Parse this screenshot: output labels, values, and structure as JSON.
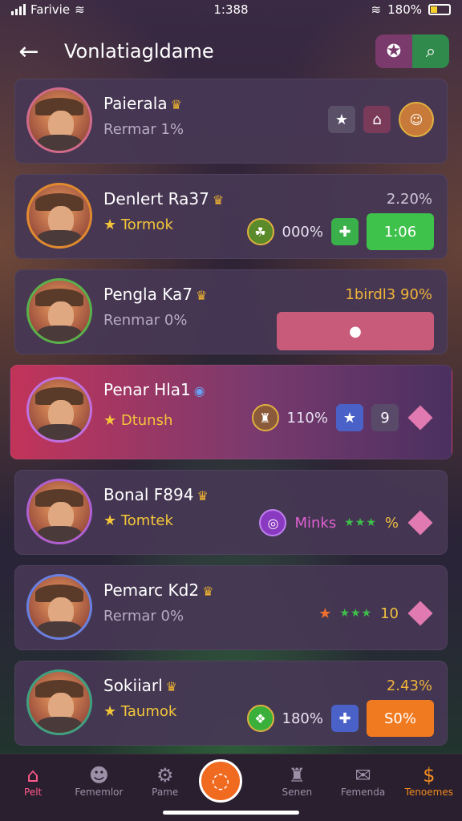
{
  "status": {
    "carrier": "Farivie",
    "time": "1:388",
    "battery": "180%"
  },
  "header": {
    "title": "Vonlatiagldame"
  },
  "cards": [
    {
      "name": "Paierala",
      "sub": "Rermar 1%",
      "right": {
        "type": "icons",
        "icons": [
          "star-icon",
          "home-icon",
          "avatar"
        ]
      }
    },
    {
      "name": "Denlert Ra37",
      "sub": "Tormok",
      "pct": "2.20%",
      "right": {
        "coin_value": "000%",
        "button": "1:06"
      }
    },
    {
      "name": "Pengla Ka7",
      "sub": "Renmar 0%",
      "pct": "1birdl3 90%",
      "right": {
        "button": ""
      }
    },
    {
      "name": "Penar Hla1",
      "sub": "Dtunsh",
      "right": {
        "coin_value": "110%",
        "badge": "9"
      }
    },
    {
      "name": "Bonal F894",
      "sub": "Tomtek",
      "right": {
        "label": "Minks",
        "stars": "★★★",
        "value": "%"
      }
    },
    {
      "name": "Pemarc Kd2",
      "sub": "Rermar 0%",
      "right": {
        "stars": "★★★",
        "value": "10"
      }
    },
    {
      "name": "Sokiiarl",
      "sub": "Taumok",
      "pct": "2.43%",
      "right": {
        "coin_value": "180%",
        "button": "S0%"
      }
    }
  ],
  "nav": [
    {
      "label": "Pelt"
    },
    {
      "label": "Fememlor"
    },
    {
      "label": "Pame"
    },
    {
      "label": ""
    },
    {
      "label": "Senen"
    },
    {
      "label": "Femenda"
    },
    {
      "label": "Tenoemes"
    }
  ]
}
